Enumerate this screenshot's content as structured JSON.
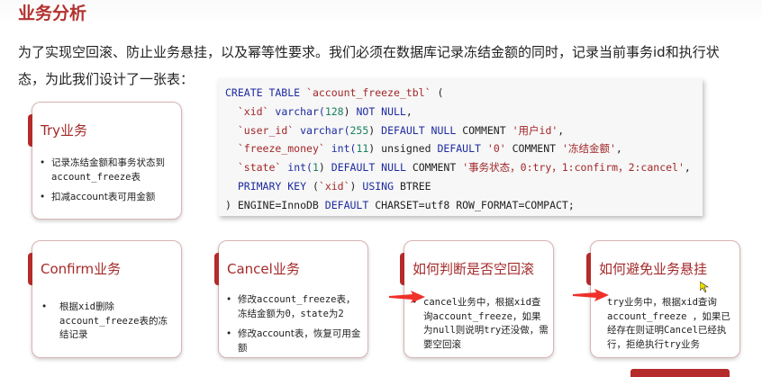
{
  "header": {
    "title": "业务分析"
  },
  "intro": "为了实现空回滚、防止业务悬挂，以及幂等性要求。我们必须在数据库记录冻结金额的同时，记录当前事务id和执行状态，为此我们设计了一张表：",
  "code": {
    "l1": [
      "CREATE TABLE",
      "`account_freeze_tbl`",
      "("
    ],
    "l2": [
      "`xid`",
      "varchar(",
      "128",
      ")",
      "NOT NULL",
      ","
    ],
    "l3": [
      "`user_id`",
      "varchar(",
      "255",
      ")",
      "DEFAULT NULL",
      "COMMENT",
      "'用户id'",
      ","
    ],
    "l4": [
      "`freeze_money`",
      "int(",
      "11",
      ") unsigned",
      "DEFAULT",
      "'0'",
      "COMMENT",
      "'冻结金额'",
      ","
    ],
    "l5": [
      "`state`",
      "int(",
      "1",
      ")",
      "DEFAULT NULL",
      "COMMENT",
      "'事务状态，0:try，1:confirm，2:cancel'",
      ","
    ],
    "l6": [
      "PRIMARY KEY",
      "(",
      "`xid`",
      ")",
      "USING",
      "BTREE"
    ],
    "l7": [
      ") ENGINE=InnoDB",
      "DEFAULT",
      "CHARSET=utf8 ROW_FORMAT=COMPACT;"
    ]
  },
  "cards": [
    {
      "title": "Try业务",
      "items": [
        "记录冻结金额和事务状态到account_freeze表",
        "扣减account表可用金额"
      ]
    },
    {
      "title": "Confirm业务",
      "items": [
        "根据xid删除account_freeze表的冻结记录"
      ]
    },
    {
      "title": "Cancel业务",
      "items": [
        "修改account_freeze表，冻结金额为0，state为2",
        "修改account表，恢复可用金额"
      ]
    },
    {
      "title": "如何判断是否空回滚",
      "items": [
        "cancel业务中，根据xid查询account_freeze，如果为null则说明try还没做，需要空回滚"
      ]
    },
    {
      "title": "如何避免业务悬挂",
      "items": [
        "try业务中，根据xid查询account_freeze ，如果已经存在则证明Cancel已经执行，拒绝执行try业务"
      ]
    }
  ],
  "bullet": "•",
  "colors": {
    "accent": "#b52a2a",
    "title": "#b2312f",
    "keyword": "#1e2aa0",
    "string": "#a3262a",
    "number": "#1c8060",
    "arrow": "#f0302a"
  }
}
